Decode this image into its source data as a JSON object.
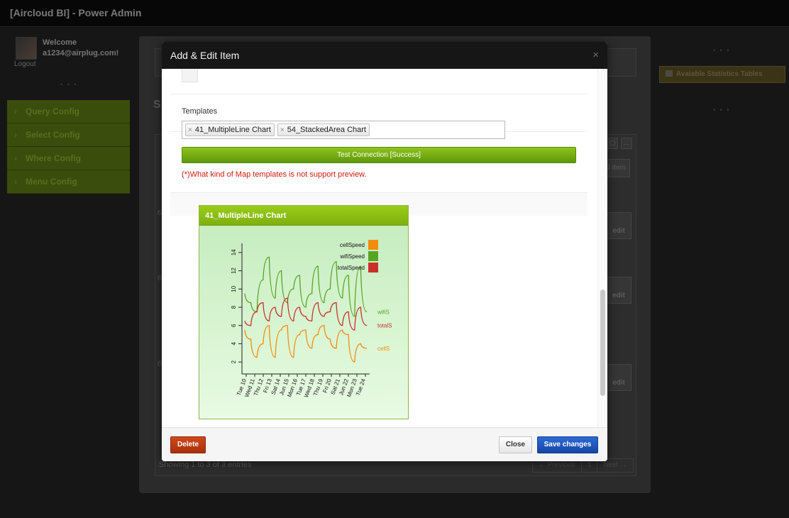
{
  "app": {
    "title": "[Aircloud BI] - Power Admin"
  },
  "user": {
    "welcome": "Welcome",
    "email": "a1234@airplug.com!",
    "logout": "Logout"
  },
  "sidebar": {
    "items": [
      {
        "label": "Query Config"
      },
      {
        "label": "Select Config"
      },
      {
        "label": "Where Config"
      },
      {
        "label": "Menu Config"
      }
    ]
  },
  "right_panel": {
    "stat_button": "Avaiable Statistics Tables"
  },
  "background_page": {
    "title_fragment": "S",
    "add_item_label": "d Item",
    "row_numbers": [
      "6",
      "6",
      "6"
    ],
    "edit_label": "edit",
    "showing": "Showing 1 to 3 of 3 entries",
    "pager": [
      "← Previous",
      "1",
      "Next →"
    ]
  },
  "modal": {
    "title": "Add & Edit Item",
    "close_glyph": "×",
    "templates_label": "Templates",
    "tags": [
      "41_MultipleLine Chart",
      "54_StackedArea Chart"
    ],
    "tag_remove_glyph": "×",
    "test_button": "Test Connection [Success]",
    "warning": "(*)What kind of Map templates is not support preview.",
    "delete_button": "Delete",
    "close_button": "Close",
    "save_button": "Save changes",
    "colors": {
      "header_bg": "#161616",
      "success_green": "#6fa80e",
      "warning_red": "#d21a0b",
      "primary_blue": "#1f58bd",
      "danger_orange": "#b83a10"
    }
  },
  "chart_data": {
    "type": "line",
    "title": "41_MultipleLine Chart",
    "categories": [
      "Tue 10",
      "Wed 11",
      "Thu 12",
      "Fri 13",
      "Sat 14",
      "Jun 15",
      "Mon 16",
      "Tue 17",
      "Wed 18",
      "Thu 19",
      "Fri 20",
      "Sat 21",
      "Jun 22",
      "Mon 23",
      "Tue 24"
    ],
    "y_ticks": [
      2,
      4,
      6,
      8,
      10,
      12,
      14
    ],
    "ylim": [
      1,
      15
    ],
    "series": [
      {
        "name": "cellSpeed",
        "color": "#f28c0f",
        "end_label": "cellS",
        "values": [
          5.5,
          4.5,
          2.5,
          4.0,
          6.0,
          2.5,
          5.5,
          6.0,
          2.5,
          5.0,
          5.5,
          3.5,
          5.0,
          6.0,
          4.5,
          3.5,
          5.5,
          5.0,
          2.0,
          4.0,
          3.5
        ]
      },
      {
        "name": "wifiSpeed",
        "color": "#58a324",
        "end_label": "wifiS",
        "values": [
          9.5,
          8.5,
          7.5,
          11.0,
          13.5,
          9.0,
          12.0,
          8.5,
          10.0,
          11.5,
          8.0,
          9.5,
          12.5,
          8.5,
          10.0,
          13.0,
          9.0,
          11.5,
          7.0,
          12.5,
          7.5
        ]
      },
      {
        "name": "totalSpeed",
        "color": "#c9302c",
        "end_label": "totalS",
        "values": [
          6.5,
          6.0,
          7.5,
          8.5,
          6.5,
          8.0,
          7.0,
          9.0,
          6.5,
          8.0,
          7.0,
          6.5,
          8.5,
          7.0,
          7.5,
          8.5,
          6.0,
          7.5,
          5.5,
          8.0,
          6.0
        ]
      }
    ],
    "legend_position": "top-right"
  }
}
